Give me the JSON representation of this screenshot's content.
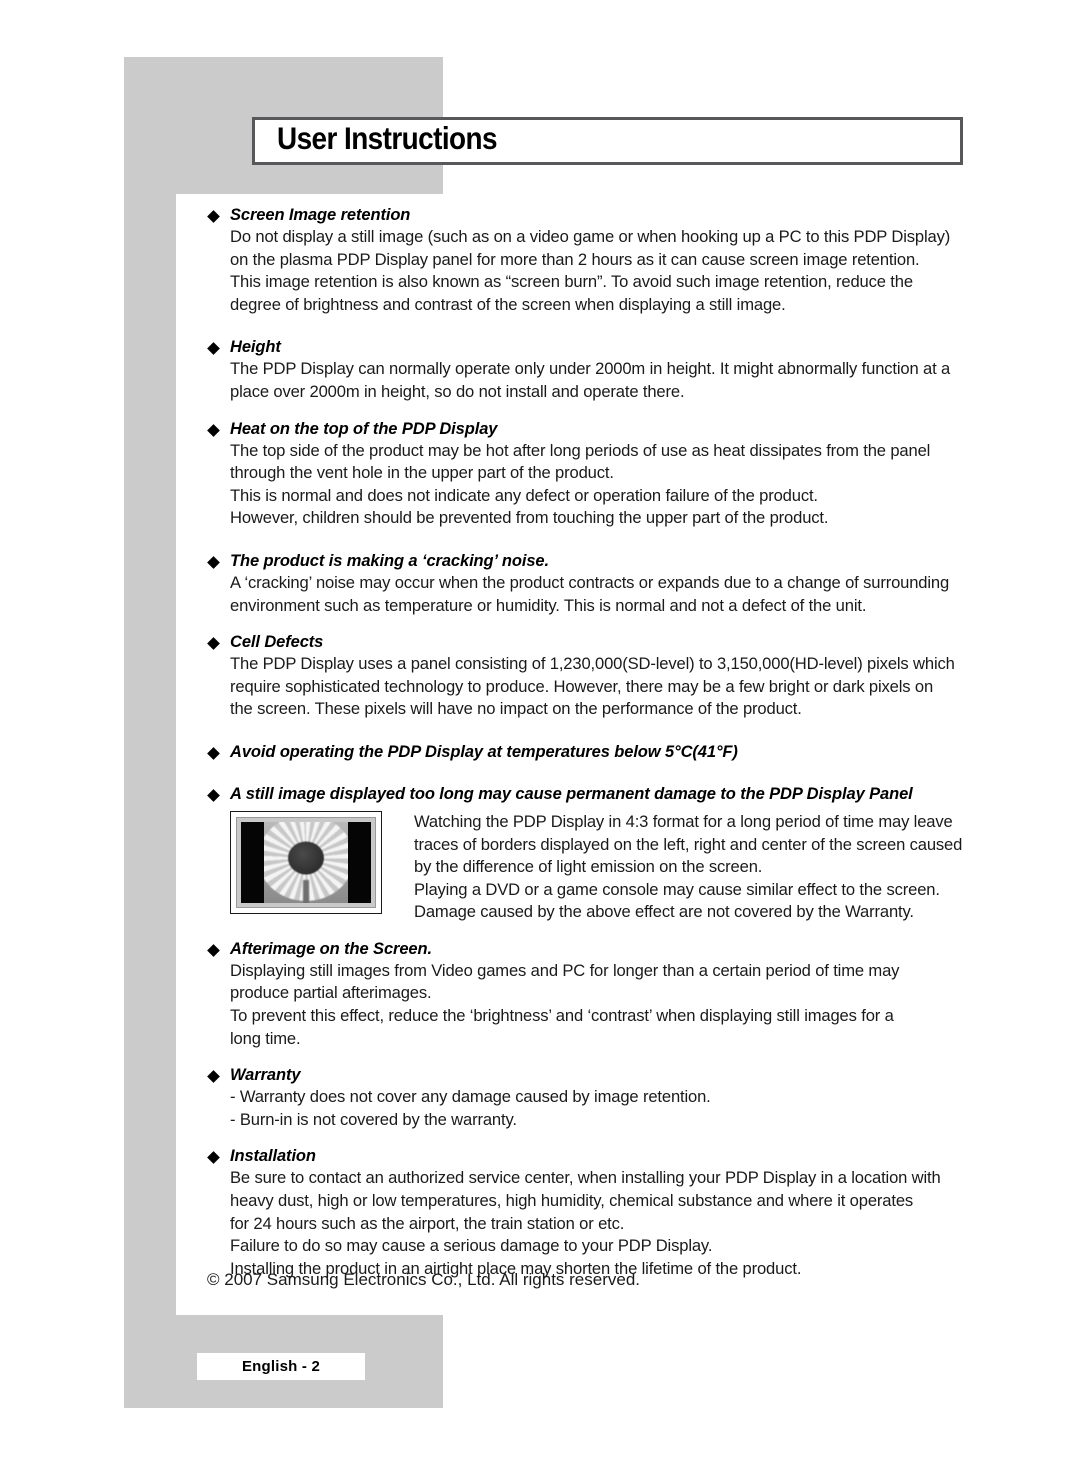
{
  "page": {
    "title": "User Instructions",
    "copyright": "© 2007 Samsung Electronics Co., Ltd. All rights reserved.",
    "page_badge": "English - 2",
    "accent_gray": "#cbcbcb",
    "border_gray": "#58585a"
  },
  "sections": [
    {
      "heading": "Screen Image retention",
      "lines": [
        "Do not display a still image (such as on a video game or when hooking up a PC to this PDP Display)",
        "on the plasma PDP Display panel for more than 2 hours as it can cause screen image retention.",
        "This image retention is also known as “screen burn”. To avoid such image retention, reduce the",
        "degree of brightness and contrast of the screen when displaying a still image."
      ]
    },
    {
      "heading": "Height",
      "lines": [
        "The PDP Display can normally operate only under 2000m in height. It might abnormally function at a",
        "place over 2000m in height, so do not install and operate there."
      ]
    },
    {
      "heading": "Heat on the top of the PDP Display",
      "lines": [
        "The top side of the product may be hot after long periods of use as heat dissipates from the panel",
        "through the vent hole in the upper part of the product.",
        "This is normal and does not indicate any defect or operation failure of the product.",
        "However, children should be prevented from touching the upper part of the product."
      ]
    },
    {
      "heading": "The product is making a ‘cracking’ noise.",
      "lines": [
        "A ‘cracking’ noise may occur when the product contracts or expands due to a change of surrounding",
        "environment such as temperature or humidity. This is normal and not a defect of the unit."
      ]
    },
    {
      "heading": "Cell Defects",
      "lines": [
        "The PDP Display uses a panel consisting of 1,230,000(SD-level) to 3,150,000(HD-level) pixels which",
        "require sophisticated technology to produce. However, there may be a few bright or dark pixels on",
        "the screen. These pixels will have no impact on the performance of the product."
      ]
    },
    {
      "heading": "Avoid operating the PDP Display at temperatures below 5°C(41°F)",
      "lines": []
    },
    {
      "heading": "A still image displayed too long may cause permanent damage to the PDP Display Panel",
      "figure": "pdp-screen-burn-illustration",
      "lines": [
        "Watching the PDP Display in 4:3 format for a long period of time may leave",
        "traces of borders displayed on the left, right and center of the screen caused",
        "by the difference of light emission on the screen.",
        "Playing a DVD or a game console may cause similar effect to the screen.",
        "Damage caused by the above effect are not covered by the Warranty."
      ]
    },
    {
      "heading": "Afterimage on the Screen.",
      "lines": [
        "Displaying still images from Video games and PC for longer than a certain period of time may",
        "produce partial afterimages.",
        "To prevent this effect, reduce the ‘brightness’ and ‘contrast’ when displaying still images for a",
        "long time."
      ]
    },
    {
      "heading": "Warranty",
      "lines": [
        "- Warranty does not cover any damage caused by image retention.",
        "- Burn-in is not covered by the warranty."
      ]
    },
    {
      "heading": "Installation",
      "lines": [
        "Be sure to contact an authorized service center, when installing your PDP Display in a location with",
        "heavy dust, high or low temperatures, high humidity, chemical substance and where it operates",
        "for 24 hours such as the airport, the train station or etc.",
        "Failure to do so may cause a serious damage to your PDP Display.",
        "Installing the product in an airtight place may shorten the lifetime of the product."
      ]
    }
  ]
}
